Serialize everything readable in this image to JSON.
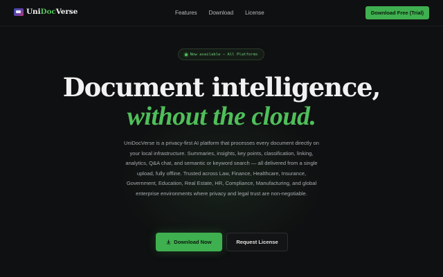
{
  "header": {
    "brand": {
      "prefix": "Uni",
      "accent": "Doc",
      "suffix": "Verse",
      "logo_icon": "unidocverse-logo"
    },
    "nav": [
      {
        "label": "Features"
      },
      {
        "label": "Download"
      },
      {
        "label": "License"
      }
    ],
    "cta_label": "Download Free (Trial)"
  },
  "hero": {
    "badge": "Now available — All Platforms",
    "headline": "Document intelligence,",
    "headline_accent": "without the cloud.",
    "description": "UniDocVerse is a privacy-first AI platform that processes every document directly on your local infrastructure. Summaries, insights, key points, classification, linking, analytics, Q&A chat, and semantic or keyword search — all delivered from a single upload, fully offline. Trusted across Law, Finance, Healthcare, Insurance, Government, Education, Real Estate, HR, Compliance, Manufacturing, and global enterprise environments where privacy and legal trust are non-negotiable.",
    "primary_button": "Download Now",
    "primary_button_icon": "download-icon",
    "secondary_button": "Request License"
  },
  "colors": {
    "background": "#0f1011",
    "accent": "#3fb04f",
    "accent_text": "#4fbf5a",
    "text": "#f1f1f1",
    "muted": "#a9adb1"
  }
}
